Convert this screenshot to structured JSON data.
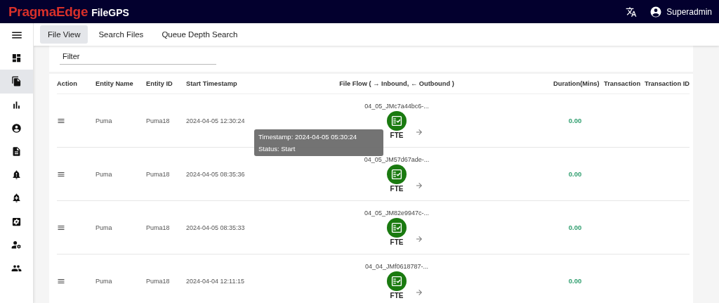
{
  "header": {
    "brand": "PragmaEdge",
    "product": "FileGPS",
    "user": "Superadmin"
  },
  "sidebar": {
    "items": [
      {
        "selected": false
      },
      {
        "selected": false
      },
      {
        "selected": true
      },
      {
        "selected": false
      },
      {
        "selected": false
      },
      {
        "selected": false
      },
      {
        "selected": false
      },
      {
        "selected": false
      },
      {
        "selected": false
      },
      {
        "selected": false
      },
      {
        "selected": false
      }
    ]
  },
  "tabs": [
    {
      "label": "File View",
      "selected": true
    },
    {
      "label": "Search Files",
      "selected": false
    },
    {
      "label": "Queue Depth Search",
      "selected": false
    }
  ],
  "filter": {
    "placeholder": "Filter"
  },
  "table": {
    "columns": [
      "Action",
      "Entity Name",
      "Entity ID",
      "Start Timestamp",
      "File Flow ( → Inbound, ← Outbound )",
      "Duration(Mins)",
      "Transaction",
      "Transaction ID"
    ],
    "rows": [
      {
        "entity_name": "Puma",
        "entity_id": "Puma18",
        "start_timestamp": "2024-04-05 12:30:24",
        "file_name": "04_05_JMc7a44bc6-...",
        "node": "FTE",
        "duration": "0.00"
      },
      {
        "entity_name": "Puma",
        "entity_id": "Puma18",
        "start_timestamp": "2024-04-05 08:35:36",
        "file_name": "04_05_JM57d67ade-...",
        "node": "FTE",
        "duration": "0.00"
      },
      {
        "entity_name": "Puma",
        "entity_id": "Puma18",
        "start_timestamp": "2024-04-05 08:35:33",
        "file_name": "04_05_JM82e9947c-...",
        "node": "FTE",
        "duration": "0.00"
      },
      {
        "entity_name": "Puma",
        "entity_id": "Puma18",
        "start_timestamp": "2024-04-04 12:11:15",
        "file_name": "04_04_JMf0618787-...",
        "node": "FTE",
        "duration": "0.00"
      }
    ]
  },
  "tooltip": {
    "lines": [
      "Timestamp: 2024-04-05 05:30:24",
      "Status: Start"
    ]
  }
}
